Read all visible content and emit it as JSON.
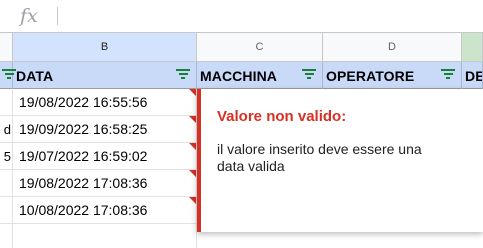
{
  "formula_bar": {
    "fx_label": "fx"
  },
  "columns": {
    "b": "B",
    "c": "C",
    "d": "D"
  },
  "fields": {
    "b": "DATA",
    "c": "MACCHINA",
    "d": "OPERATORE",
    "e": "DE"
  },
  "rows": [
    {
      "a": "",
      "b": "19/08/2022 16:55:56"
    },
    {
      "a": "d",
      "b": "19/09/2022 16:58:25"
    },
    {
      "a": "5",
      "b": "19/07/2022 16:59:02"
    },
    {
      "a": "",
      "b": "19/08/2022 17:08:36"
    },
    {
      "a": "",
      "b": "10/08/2022 17:08:36"
    }
  ],
  "validation_popup": {
    "title": "Valore non valido:",
    "message": "il valore inserito deve essere una data valida"
  },
  "colors": {
    "header_fill": "#c9daf8",
    "error_red": "#d93025",
    "filter_green": "#188038"
  }
}
